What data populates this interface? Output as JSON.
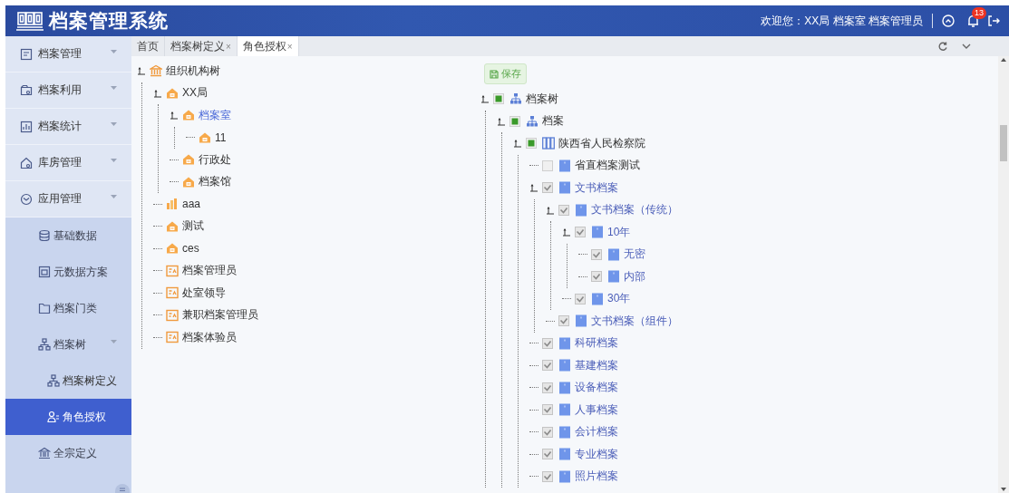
{
  "header": {
    "title": "档案管理系统",
    "welcome": "欢迎您：XX局 档案室 档案管理员",
    "notification_count": "13"
  },
  "sidebar": {
    "items": [
      {
        "label": "档案管理",
        "caret": true,
        "selected": false
      },
      {
        "label": "档案利用",
        "caret": true,
        "selected": false
      },
      {
        "label": "档案统计",
        "caret": true,
        "selected": false
      },
      {
        "label": "库房管理",
        "caret": true,
        "selected": false
      },
      {
        "label": "应用管理",
        "caret": true,
        "selected": false,
        "children": [
          {
            "label": "基础数据",
            "caret": false,
            "selected": false
          },
          {
            "label": "元数据方案",
            "caret": false,
            "selected": false
          },
          {
            "label": "档案门类",
            "caret": false,
            "selected": false
          },
          {
            "label": "档案树",
            "caret": true,
            "selected": false,
            "children": [
              {
                "label": "档案树定义",
                "caret": false,
                "selected": false
              },
              {
                "label": "角色授权",
                "caret": false,
                "selected": true
              }
            ]
          },
          {
            "label": "全宗定义",
            "caret": false,
            "selected": false
          }
        ]
      }
    ]
  },
  "tabs": [
    {
      "label": "首页",
      "selected": false
    },
    {
      "label": "档案树定义",
      "close": "×",
      "selected": false
    },
    {
      "label": "角色授权",
      "close": "×",
      "selected": true
    }
  ],
  "org_tree": {
    "nodes": [
      {
        "label": "组织机构树",
        "kind": "organization",
        "selected": false,
        "expanded": true,
        "children": [
          {
            "label": "XX局",
            "kind": "department",
            "selected": false,
            "expanded": true,
            "children": [
              {
                "label": "档案室",
                "kind": "department",
                "selected": true,
                "expanded": true,
                "children": [
                  {
                    "label": "11",
                    "kind": "department",
                    "selected": false
                  }
                ]
              },
              {
                "label": "行政处",
                "kind": "department",
                "selected": false
              },
              {
                "label": "档案馆",
                "kind": "department",
                "selected": false
              }
            ]
          },
          {
            "label": "aaa",
            "kind": "group",
            "selected": false
          },
          {
            "label": "测试",
            "kind": "department",
            "selected": false
          },
          {
            "label": "ces",
            "kind": "department",
            "selected": false
          },
          {
            "label": "档案管理员",
            "kind": "role",
            "selected": false
          },
          {
            "label": "处室领导",
            "kind": "role",
            "selected": false
          },
          {
            "label": "兼职档案管理员",
            "kind": "role",
            "selected": false
          },
          {
            "label": "档案体验员",
            "kind": "role",
            "selected": false
          }
        ]
      }
    ]
  },
  "permission_tree": {
    "save_button": "保存",
    "nodes": [
      {
        "label": "档案树",
        "kind": "hierarchy",
        "checked": false,
        "indeterminate": true,
        "expanded": true,
        "children": [
          {
            "label": "档案",
            "kind": "hierarchy",
            "checked": false,
            "indeterminate": true,
            "expanded": true,
            "children": [
              {
                "label": "陕西省人民检察院",
                "kind": "library",
                "checked": false,
                "indeterminate": true,
                "expanded": true,
                "children": [
                  {
                    "label": "省直档案测试",
                    "kind": "category",
                    "checked": false,
                    "indeterminate": false
                  },
                  {
                    "label": "文书档案",
                    "kind": "category",
                    "checked": true,
                    "indeterminate": false,
                    "expanded": true,
                    "children": [
                      {
                        "label": "文书档案（传统）",
                        "kind": "category",
                        "checked": true,
                        "indeterminate": false,
                        "expanded": true,
                        "children": [
                          {
                            "label": "10年",
                            "kind": "category",
                            "checked": true,
                            "indeterminate": false,
                            "expanded": true,
                            "children": [
                              {
                                "label": "无密",
                                "kind": "category",
                                "checked": true,
                                "indeterminate": false
                              },
                              {
                                "label": "内部",
                                "kind": "category",
                                "checked": true,
                                "indeterminate": false
                              }
                            ]
                          },
                          {
                            "label": "30年",
                            "kind": "category",
                            "checked": true,
                            "indeterminate": false
                          }
                        ]
                      },
                      {
                        "label": "文书档案（组件）",
                        "kind": "category",
                        "checked": true,
                        "indeterminate": false
                      }
                    ]
                  },
                  {
                    "label": "科研档案",
                    "kind": "category",
                    "checked": true,
                    "indeterminate": false
                  },
                  {
                    "label": "基建档案",
                    "kind": "category",
                    "checked": true,
                    "indeterminate": false
                  },
                  {
                    "label": "设备档案",
                    "kind": "category",
                    "checked": true,
                    "indeterminate": false
                  },
                  {
                    "label": "人事档案",
                    "kind": "category",
                    "checked": true,
                    "indeterminate": false
                  },
                  {
                    "label": "会计档案",
                    "kind": "category",
                    "checked": true,
                    "indeterminate": false
                  },
                  {
                    "label": "专业档案",
                    "kind": "category",
                    "checked": true,
                    "indeterminate": false
                  },
                  {
                    "label": "照片档案",
                    "kind": "category",
                    "checked": true,
                    "indeterminate": false
                  }
                ]
              }
            ]
          }
        ]
      }
    ]
  }
}
